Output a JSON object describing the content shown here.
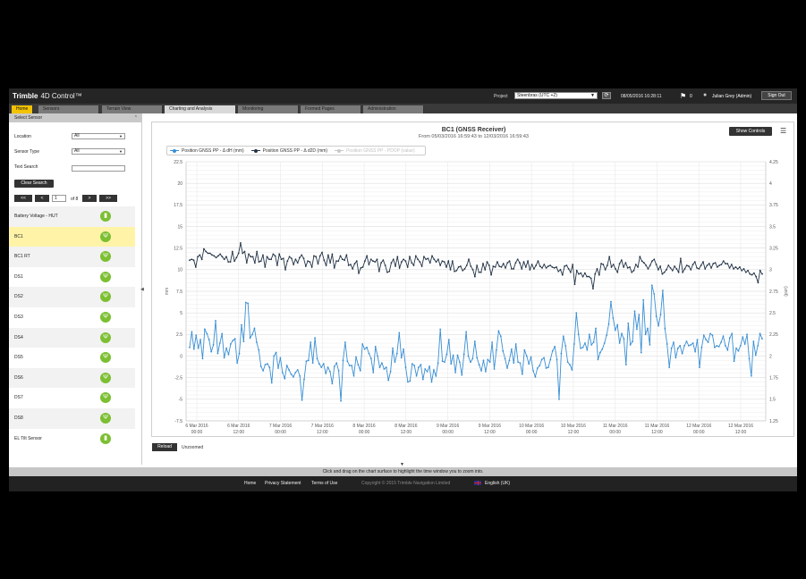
{
  "header": {
    "brand": "Trimble",
    "product": "4D Control™",
    "project_label": "Project",
    "project_value": "Steenbras (UTC +2)",
    "datetime": "08/05/2016 16:28:11",
    "flag_count": "0",
    "user": "Julian Grey (Admin)",
    "signout_label": "Sign Out"
  },
  "tabs": [
    {
      "label": "Home"
    },
    {
      "label": "Sensors"
    },
    {
      "label": "Terrain View"
    },
    {
      "label": "Charting and Analysis"
    },
    {
      "label": "Monitoring"
    },
    {
      "label": "Formed Pages"
    },
    {
      "label": "Administration"
    }
  ],
  "sidebar": {
    "header": "Select Sensor",
    "location_label": "Location",
    "location_value": "All",
    "sensor_type_label": "Sensor Type",
    "sensor_type_value": "All",
    "text_search_label": "Text Search",
    "clear_search_label": "Clear Search",
    "pager": {
      "first": "<<",
      "prev": "<",
      "page": "1",
      "of": "of 8",
      "next": ">",
      "last": ">>"
    },
    "sensors": [
      {
        "name": "Battery Voltage - HUT",
        "icon": "battery-icon"
      },
      {
        "name": "BC1",
        "icon": "gnss-antenna-icon",
        "selected": true
      },
      {
        "name": "BC1 RT",
        "icon": "gnss-antenna-icon"
      },
      {
        "name": "DS1",
        "icon": "gnss-antenna-icon"
      },
      {
        "name": "DS2",
        "icon": "gnss-antenna-icon"
      },
      {
        "name": "DS3",
        "icon": "gnss-antenna-icon"
      },
      {
        "name": "DS4",
        "icon": "gnss-antenna-icon"
      },
      {
        "name": "DS5",
        "icon": "gnss-antenna-icon"
      },
      {
        "name": "DS6",
        "icon": "gnss-antenna-icon"
      },
      {
        "name": "DS7",
        "icon": "gnss-antenna-icon"
      },
      {
        "name": "DS8",
        "icon": "gnss-antenna-icon"
      },
      {
        "name": "EL Tilt Sensor",
        "icon": "tilt-sensor-icon"
      }
    ]
  },
  "chart_panel": {
    "title": "BC1 (GNSS Receiver)",
    "subtitle": "From 05/03/2016 16:59:43 to 12/03/2016 16:59:43",
    "show_controls_label": "Show Controls",
    "reload_label": "Reload",
    "zoom_state": "Unzoomed"
  },
  "chart_data": {
    "type": "line",
    "x_ticks": [
      {
        "l1": "6 Mar 2016",
        "l2": "00:00"
      },
      {
        "l1": "6 Mar 2016",
        "l2": "12:00"
      },
      {
        "l1": "7 Mar 2016",
        "l2": "00:00"
      },
      {
        "l1": "7 Mar 2016",
        "l2": "12:00"
      },
      {
        "l1": "8 Mar 2016",
        "l2": "00:00"
      },
      {
        "l1": "8 Mar 2016",
        "l2": "12:00"
      },
      {
        "l1": "9 Mar 2016",
        "l2": "00:00"
      },
      {
        "l1": "9 Mar 2016",
        "l2": "12:00"
      },
      {
        "l1": "10 Mar 2016",
        "l2": "00:00"
      },
      {
        "l1": "10 Mar 2016",
        "l2": "12:00"
      },
      {
        "l1": "11 Mar 2016",
        "l2": "00:00"
      },
      {
        "l1": "11 Mar 2016",
        "l2": "12:00"
      },
      {
        "l1": "12 Mar 2016",
        "l2": "00:00"
      },
      {
        "l1": "12 Mar 2016",
        "l2": "12:00"
      }
    ],
    "ylabel_left": "mm",
    "ylabel_right": "(unit)",
    "ylim_left": [
      -7.5,
      22.5
    ],
    "yticks_left": [
      "22.5",
      "20",
      "17.5",
      "15",
      "12.5",
      "10",
      "7.5",
      "5",
      "2.5",
      "0",
      "-2.5",
      "-5",
      "-7.5"
    ],
    "ylim_right": [
      1.25,
      4.25
    ],
    "yticks_right": [
      "4.25",
      "4",
      "3.75",
      "3.5",
      "3.25",
      "3",
      "2.75",
      "2.5",
      "2.25",
      "2",
      "1.75",
      "1.5",
      "1.25"
    ],
    "series": [
      {
        "name": "Position GNSS PP - Δ dH (mm)",
        "color": "#3a8fd4",
        "values": [
          1.0,
          2.8,
          0.8,
          2.4,
          0.9,
          1.9,
          -0.3,
          3.1,
          2.6,
          1.9,
          0.5,
          1.3,
          4.1,
          0.3,
          1.5,
          2.6,
          -0.2,
          0.9,
          0.2,
          1.4,
          1.8,
          2.0,
          -0.8,
          0.3,
          3.6,
          1.7,
          6.2,
          6.1,
          2.1,
          2.5,
          3.2,
          1.6,
          0.7,
          -1.2,
          -1.7,
          -1.0,
          -0.9,
          -1.3,
          -3.1,
          0.0,
          0.4,
          -1.4,
          -0.2,
          -1.9,
          -2.6,
          -1.1,
          -1.6,
          -2.1,
          -2.4,
          -1.9,
          -1.6,
          -2.3,
          -5.1,
          -2.7,
          -0.6,
          -0.5,
          1.6,
          -0.8,
          2.1,
          -0.3,
          -0.9,
          -1.3,
          -0.9,
          -2.0,
          -1.3,
          -1.8,
          -3.2,
          -1.2,
          -0.8,
          -1.7,
          -5.2,
          -0.5,
          1.6,
          -0.6,
          -1.1,
          -1.1,
          -2.3,
          -0.1,
          -1.0,
          -1.7,
          1.4,
          0.8,
          1.0,
          0.3,
          -0.3,
          -1.9,
          1.1,
          0.0,
          -1.3,
          -0.8,
          -1.5,
          -1.3,
          -2.8,
          -1.8,
          0.9,
          -0.7,
          0.3,
          2.7,
          -0.2,
          0.8,
          -1.3,
          -3.0,
          -2.9,
          -0.9,
          -1.1,
          -2.3,
          -1.3,
          -1.0,
          -2.7,
          -1.5,
          -1.8,
          -1.2,
          -3.0,
          -1.6,
          -2.3,
          -0.8,
          3.1,
          -0.6,
          -0.7,
          0.2,
          1.9,
          -0.9,
          0.1,
          -1.9,
          0.1,
          -0.7,
          -2.2,
          0.2,
          2.8,
          0.0,
          -0.7,
          -0.3,
          1.7,
          -0.2,
          -1.0,
          -1.7,
          -0.5,
          -1.8,
          -0.4,
          -0.7,
          1.6,
          -1.5,
          0.7,
          2.9,
          2.3,
          0.6,
          -0.3,
          -1.4,
          -0.5,
          0.8,
          -0.8,
          1.4,
          -0.7,
          -0.8,
          -2.1,
          0.7,
          0.0,
          -0.9,
          -0.1,
          -1.7,
          -2.4,
          -1.4,
          -1.1,
          -0.4,
          -0.2,
          -1.4,
          -1.3,
          -0.4,
          0.6,
          1.1,
          -0.4,
          -5.0,
          0.3,
          2.3,
          1.2,
          -0.7,
          -1.0,
          -1.6,
          1.4,
          5.0,
          2.5,
          0.9,
          1.0,
          1.5,
          0.7,
          2.5,
          1.3,
          1.6,
          3.2,
          -0.4,
          0.4,
          0.8,
          1.5,
          2.4,
          3.7,
          6.3,
          4.4,
          3.0,
          3.6,
          1.5,
          2.6,
          2.0,
          -1.0,
          3.8,
          1.3,
          1.7,
          5.2,
          3.1,
          4.8,
          0.4,
          6.5,
          2.5,
          3.2,
          1.3,
          8.2,
          7.2,
          4.6,
          3.5,
          4.8,
          7.6,
          3.2,
          1.4,
          -1.3,
          0.9,
          1.6,
          -0.2,
          0.9,
          1.2,
          0.3,
          1.2,
          1.7,
          1.2,
          1.3,
          1.5,
          0.5,
          1.9,
          -1.3,
          1.0,
          2.4,
          1.9,
          1.6,
          2.6,
          2.4,
          1.0,
          1.2,
          1.1,
          1.6,
          2.3,
          1.2,
          0.7,
          2.1,
          2.6,
          -0.6,
          0.9,
          0.6,
          1.2,
          2.2,
          1.4,
          2.5,
          -0.3,
          -2.3,
          1.7,
          0.1,
          1.2,
          2.6,
          2.0
        ]
      },
      {
        "name": "Position GNSS PP - Δ d2D (mm)",
        "color": "#243447",
        "values": [
          11.1,
          11.2,
          11.1,
          10.3,
          11.5,
          11.7,
          11.2,
          12.4,
          12.1,
          11.9,
          11.9,
          11.7,
          11.6,
          11.4,
          11.6,
          11.8,
          11.5,
          11.2,
          11.5,
          10.9,
          10.9,
          12.1,
          11.0,
          11.4,
          11.9,
          13.1,
          11.9,
          12.1,
          10.8,
          11.8,
          11.5,
          11.5,
          10.8,
          12.1,
          10.9,
          11.0,
          11.7,
          10.3,
          11.5,
          11.2,
          11.2,
          11.8,
          11.6,
          10.5,
          11.8,
          11.2,
          11.3,
          10.0,
          11.0,
          11.5,
          11.3,
          10.6,
          11.2,
          10.8,
          11.4,
          11.7,
          11.3,
          10.4,
          11.0,
          10.9,
          10.3,
          11.6,
          11.5,
          10.7,
          11.6,
          12.0,
          11.1,
          10.5,
          11.7,
          10.8,
          11.8,
          10.2,
          11.0,
          11.0,
          11.6,
          11.2,
          11.1,
          11.7,
          10.5,
          10.6,
          10.1,
          10.7,
          11.0,
          9.6,
          10.2,
          10.3,
          11.0,
          11.6,
          10.6,
          11.2,
          11.0,
          10.9,
          11.2,
          9.8,
          10.8,
          11.1,
          10.5,
          9.7,
          9.8,
          10.8,
          11.2,
          10.4,
          11.5,
          10.2,
          10.9,
          11.2,
          11.0,
          10.3,
          11.5,
          10.8,
          10.5,
          11.6,
          11.2,
          10.9,
          10.4,
          11.5,
          11.2,
          11.3,
          10.8,
          11.6,
          11.2,
          10.9,
          11.2,
          10.5,
          11.0,
          10.9,
          10.3,
          11.0,
          10.0,
          11.0,
          9.8,
          9.9,
          10.3,
          10.4,
          9.9,
          10.1,
          10.5,
          11.2,
          10.4,
          10.0,
          9.2,
          10.5,
          9.7,
          9.7,
          10.7,
          10.0,
          10.9,
          10.5,
          9.4,
          10.4,
          10.3,
          10.9,
          10.4,
          10.3,
          10.7,
          10.2,
          10.8,
          11.0,
          10.1,
          10.1,
          10.8,
          11.2,
          10.8,
          10.1,
          10.9,
          10.3,
          11.0,
          10.0,
          10.6,
          10.1,
          10.5,
          11.0,
          10.4,
          10.2,
          10.6,
          10.2,
          10.4,
          10.5,
          10.3,
          10.2,
          10.3,
          9.8,
          10.0,
          9.4,
          10.4,
          10.5,
          10.1,
          9.7,
          10.6,
          8.3,
          9.9,
          9.5,
          9.6,
          9.2,
          9.6,
          9.2,
          9.2,
          9.0,
          7.8,
          9.5,
          10.1,
          9.4,
          10.7,
          10.6,
          10.0,
          10.5,
          11.5,
          10.3,
          10.6,
          10.1,
          9.7,
          10.7,
          11.1,
          10.3,
          10.8,
          10.2,
          10.3,
          9.7,
          9.9,
          10.6,
          10.3,
          11.5,
          11.0,
          10.8,
          10.5,
          10.1,
          10.5,
          11.0,
          11.2,
          10.6,
          10.0,
          10.4,
          9.5,
          9.7,
          10.0,
          10.5,
          10.2,
          9.9,
          10.4,
          10.1,
          9.7,
          11.3,
          9.7,
          10.1,
          10.5,
          10.4,
          10.0,
          10.6,
          10.9,
          10.2,
          10.1,
          10.5,
          10.9,
          10.1,
          10.5,
          10.7,
          10.2,
          10.7,
          10.8,
          10.3,
          10.5,
          10.6,
          11.0,
          10.7,
          10.7,
          10.2,
          10.6,
          10.1,
          10.3,
          10.1,
          10.3,
          9.9,
          10.1,
          9.7,
          9.9,
          9.5,
          9.4,
          9.6,
          9.2,
          8.5,
          9.9,
          9.5
        ]
      },
      {
        "name": "Position GNSS PP - PDOP (value)",
        "color": "#c8c8c8",
        "values": [],
        "hidden": true
      }
    ],
    "grid": true,
    "legend": "top-left"
  },
  "hint": "Click and drag on the chart surface to highlight the time window you to zoom into.",
  "footer": {
    "home": "Home",
    "privacy": "Privacy Statement",
    "terms": "Terms of Use",
    "copyright": "Copyright © 2015 Trimble Navigation Limited",
    "language": "English (UK)"
  }
}
